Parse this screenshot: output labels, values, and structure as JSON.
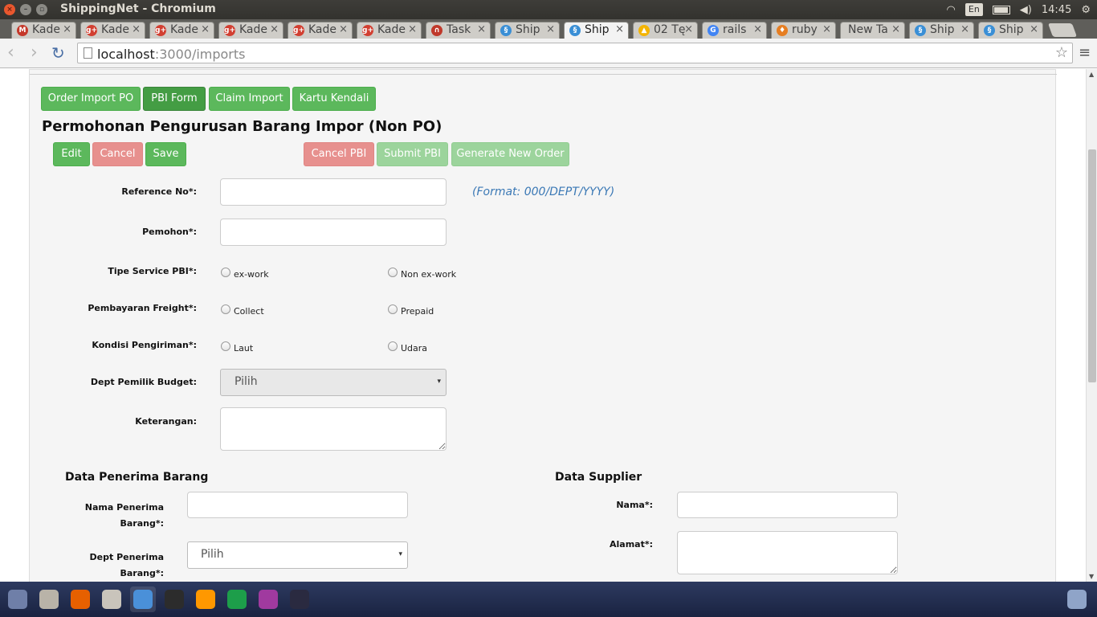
{
  "window": {
    "title": "ShippingNet - Chromium",
    "close_glyph": "×",
    "min_glyph": "–",
    "max_glyph": "▫"
  },
  "tray": {
    "lang": "En",
    "time": "14:45",
    "wifi_icon": "wifi-icon",
    "volume_icon": "volume-icon",
    "battery_icon": "battery-icon",
    "gear_icon": "gear-icon",
    "wifi_glyph": "◠",
    "volume_glyph": "◀)",
    "gear_glyph": "⚙"
  },
  "tabs": [
    {
      "label": "Kade",
      "icon": "gmail-icon",
      "glyph": "M",
      "color": "#c5382a"
    },
    {
      "label": "Kade",
      "icon": "google-plus-icon",
      "glyph": "g+",
      "color": "#d23f31"
    },
    {
      "label": "Kade",
      "icon": "google-plus-icon",
      "glyph": "g+",
      "color": "#d23f31"
    },
    {
      "label": "Kade",
      "icon": "google-plus-icon",
      "glyph": "g+",
      "color": "#d23f31"
    },
    {
      "label": "Kade",
      "icon": "google-plus-icon",
      "glyph": "g+",
      "color": "#d23f31"
    },
    {
      "label": "Kade",
      "icon": "google-plus-icon",
      "glyph": "g+",
      "color": "#d23f31"
    },
    {
      "label": "Task",
      "icon": "task-icon",
      "glyph": "∩",
      "color": "#c0392b"
    },
    {
      "label": "Ship",
      "icon": "shippingnet-icon",
      "glyph": "§",
      "color": "#3a8fd6"
    },
    {
      "label": "Ship",
      "icon": "shippingnet-icon",
      "glyph": "§",
      "color": "#3a8fd6",
      "active": true
    },
    {
      "label": "02 Tę",
      "icon": "drive-icon",
      "glyph": "▲",
      "color": "#f4b400"
    },
    {
      "label": "rails",
      "icon": "google-icon",
      "glyph": "G",
      "color": "#4285f4"
    },
    {
      "label": "ruby",
      "icon": "ruby-icon",
      "glyph": "♦",
      "color": "#e67e22"
    },
    {
      "label": "New Ta",
      "icon": "",
      "glyph": "",
      "color": "transparent"
    },
    {
      "label": "Ship",
      "icon": "shippingnet-icon",
      "glyph": "§",
      "color": "#3a8fd6"
    },
    {
      "label": "Ship",
      "icon": "shippingnet-icon",
      "glyph": "§",
      "color": "#3a8fd6"
    }
  ],
  "tab_close_glyph": "×",
  "browser": {
    "url_host": "localhost",
    "url_rest": ":3000/imports",
    "back_glyph": "‹",
    "forward_glyph": "›",
    "reload_glyph": "↻",
    "star_glyph": "☆",
    "menu_glyph": "≡"
  },
  "nav_buttons": [
    {
      "label": "Order Import PO"
    },
    {
      "label": "PBI Form",
      "active": true
    },
    {
      "label": "Claim Import"
    },
    {
      "label": "Kartu Kendali"
    }
  ],
  "page_title": "Permohonan Pengurusan Barang Impor (Non PO)",
  "actions": {
    "edit": "Edit",
    "cancel": "Cancel",
    "save": "Save",
    "cancel_pbi": "Cancel PBI",
    "submit_pbi": "Submit PBI",
    "generate": "Generate New Order"
  },
  "form": {
    "reference_label": "Reference No*:",
    "reference_value": "",
    "reference_hint": "(Format: 000/DEPT/YYYY)",
    "pemohon_label": "Pemohon*:",
    "pemohon_value": "",
    "tipe_label": "Tipe Service PBI*:",
    "tipe_options": [
      "ex-work",
      "Non ex-work"
    ],
    "freight_label": "Pembayaran Freight*:",
    "freight_options": [
      "Collect",
      "Prepaid"
    ],
    "kondisi_label": "Kondisi Pengiriman*:",
    "kondisi_options": [
      "Laut",
      "Udara"
    ],
    "dept_budget_label": "Dept Pemilik Budget:",
    "dept_budget_value": "Pilih",
    "keterangan_label": "Keterangan:",
    "keterangan_value": ""
  },
  "penerima": {
    "title": "Data Penerima Barang",
    "nama_label_1": "Nama Penerima",
    "nama_label_2": "Barang*:",
    "nama_value": "",
    "dept_label_1": "Dept Penerima",
    "dept_label_2": "Barang*:",
    "dept_value": "Pilih"
  },
  "supplier": {
    "title": "Data Supplier",
    "nama_label": "Nama*:",
    "nama_value": "",
    "alamat_label": "Alamat*:",
    "alamat_value": ""
  },
  "select_caret": "▾",
  "taskbar": [
    {
      "icon": "ubuntu-dash-icon",
      "color": "#6f7fa8"
    },
    {
      "icon": "file-manager-icon",
      "color": "#b9b3a8"
    },
    {
      "icon": "firefox-icon",
      "color": "#e66000"
    },
    {
      "icon": "system-settings-icon",
      "color": "#c9c4bb"
    },
    {
      "icon": "chromium-icon",
      "color": "#4a90d9",
      "active": true
    },
    {
      "icon": "terminal-icon",
      "color": "#2c2c2c"
    },
    {
      "icon": "sublime-text-icon",
      "color": "#ff9800"
    },
    {
      "icon": "libreoffice-calc-icon",
      "color": "#1d9e4a"
    },
    {
      "icon": "app-window-icon",
      "color": "#a03a9f"
    },
    {
      "icon": "workspace-switcher-icon",
      "color": "#2a2a40"
    },
    {
      "icon": "trash-icon",
      "color": "#8fa4c8"
    }
  ]
}
